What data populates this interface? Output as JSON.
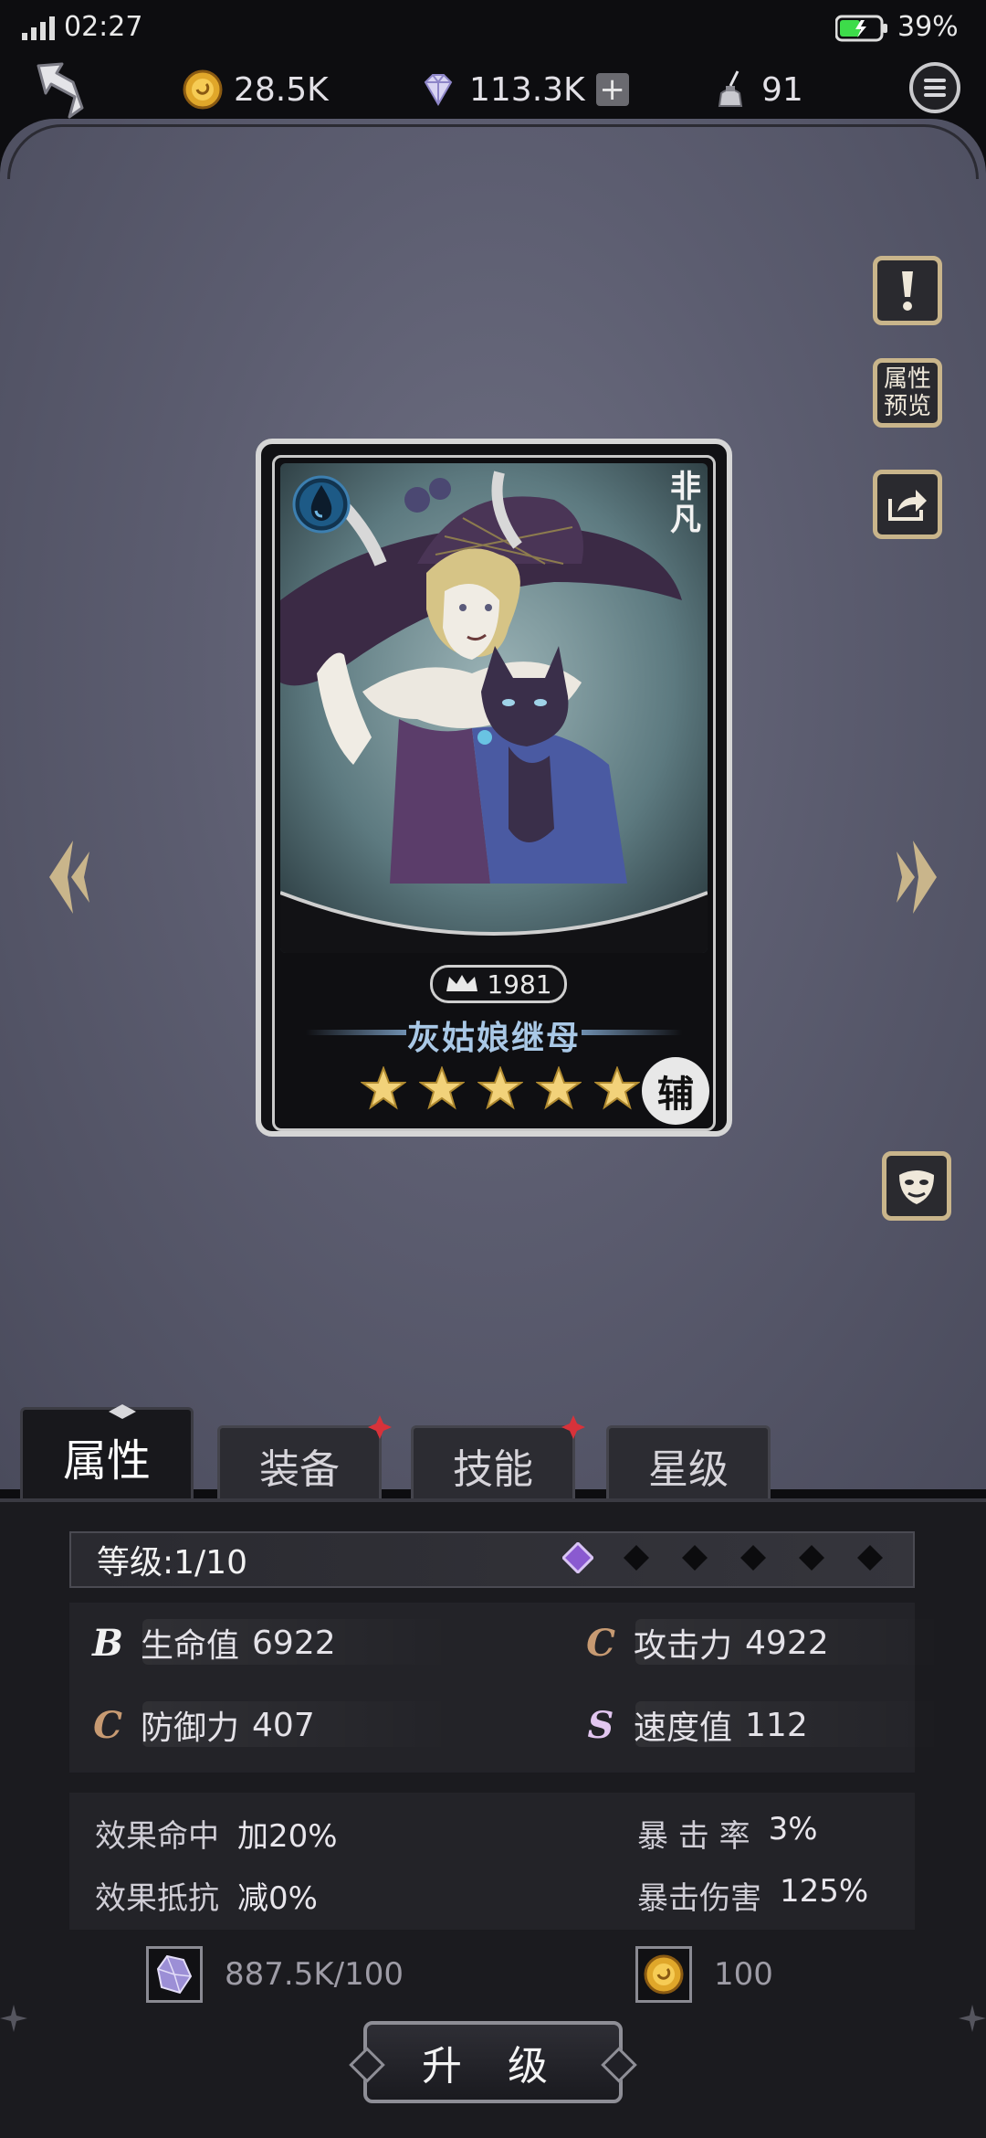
{
  "status_bar": {
    "time": "02:27",
    "battery": "39%"
  },
  "resources": {
    "gold": "28.5K",
    "gems": "113.3K",
    "ink": "91",
    "plus_label": "+"
  },
  "side_buttons": {
    "preview_line1": "属性",
    "preview_line2": "预览"
  },
  "card": {
    "power": "1981",
    "name": "灰姑娘继母",
    "rarity": "非凡",
    "role": "辅",
    "stars": 5,
    "element": "water-drop-icon"
  },
  "tabs": [
    "属性",
    "装备",
    "技能",
    "星级"
  ],
  "level": {
    "label": "等级:1/10",
    "filled": 1,
    "total": 6
  },
  "stats": [
    {
      "grade": "B",
      "label": "生命值",
      "value": "6922"
    },
    {
      "grade": "C",
      "label": "攻击力",
      "value": "4922"
    },
    {
      "grade": "C",
      "label": "防御力",
      "value": "407"
    },
    {
      "grade": "S",
      "label": "速度值",
      "value": "112"
    }
  ],
  "extra_stats": [
    {
      "label": "效果命中",
      "value": "加20%"
    },
    {
      "label": "效果抵抗",
      "value": "减0%"
    },
    {
      "label": "暴 击 率",
      "value": "3%"
    },
    {
      "label": "暴击伤害",
      "value": "125%"
    }
  ],
  "costs": {
    "crystal": "887.5K/100",
    "gold": "100"
  },
  "upgrade_label": "升 级",
  "colors": {
    "panel_bg": "#1b1b1f",
    "stage_bg": "#5c5d70",
    "name_color": "#a9c8e6",
    "frame_gold": "#c9b58b"
  }
}
